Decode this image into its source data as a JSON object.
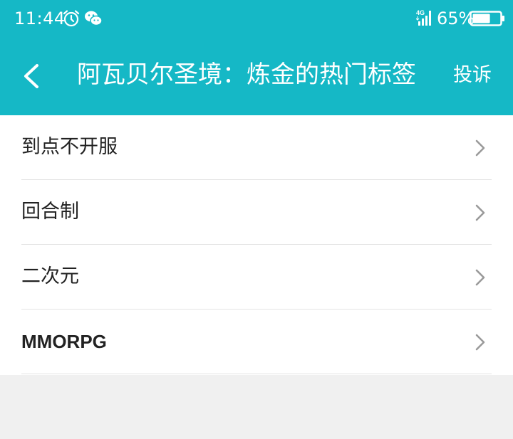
{
  "status_bar": {
    "time": "11:44",
    "network": "4G",
    "battery_percent": "65%",
    "battery_level": 0.65,
    "icons": [
      "alarm-icon",
      "wechat-icon",
      "signal-icon",
      "battery-icon"
    ]
  },
  "header": {
    "title": "阿瓦贝尔圣境：炼金的热门标签",
    "report_label": "投诉",
    "back_icon": "chevron-left-icon"
  },
  "tags": [
    {
      "label": "到点不开服"
    },
    {
      "label": "回合制"
    },
    {
      "label": "二次元"
    },
    {
      "label": "MMORPG"
    }
  ],
  "colors": {
    "header_bg": "#15b8c6",
    "list_bg": "#ffffff",
    "page_bg": "#f0f0f0",
    "text": "#222222",
    "chevron": "#9a9a9a"
  }
}
